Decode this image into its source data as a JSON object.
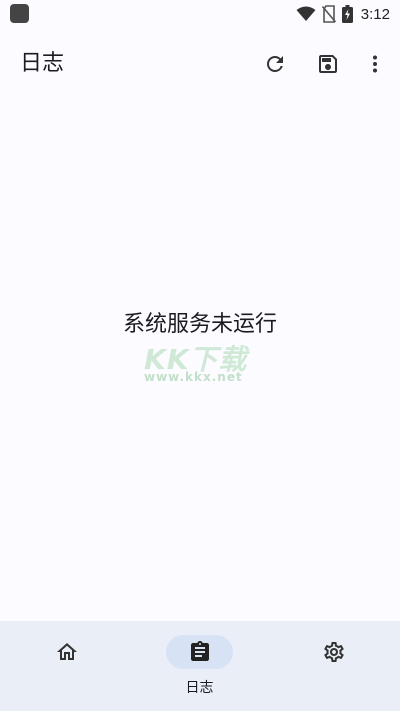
{
  "status_bar": {
    "time": "3:12",
    "icons": [
      "app-notification-icon",
      "wifi-icon",
      "no-sim-icon",
      "battery-charging-icon"
    ]
  },
  "app_bar": {
    "title": "日志",
    "actions": [
      {
        "name": "refresh",
        "icon": "refresh-icon"
      },
      {
        "name": "save",
        "icon": "save-icon"
      },
      {
        "name": "more",
        "icon": "more-vert-icon"
      }
    ]
  },
  "content": {
    "message": "系统服务未运行"
  },
  "watermark": {
    "url": "www.kkx.net"
  },
  "bottom_nav": {
    "items": [
      {
        "icon": "home-icon",
        "label": "",
        "active": false
      },
      {
        "icon": "clipboard-icon",
        "label": "日志",
        "active": true
      },
      {
        "icon": "gear-icon",
        "label": "",
        "active": false
      }
    ]
  },
  "colors": {
    "background": "#fcfbff",
    "nav_background": "#eaeef7",
    "active_indicator": "#d8e2f5",
    "text": "#1c1b1f"
  }
}
